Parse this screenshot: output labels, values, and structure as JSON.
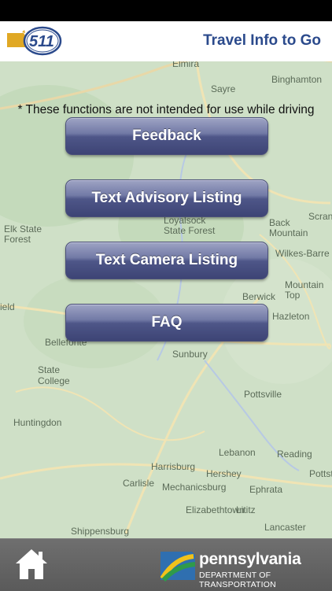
{
  "header": {
    "title": "Travel Info to Go",
    "logo_text": "511"
  },
  "disclaimer": "* These functions are not intended for use while driving",
  "menu": [
    {
      "label": "Feedback"
    },
    {
      "label": "Text Advisory Listing"
    },
    {
      "label": "Text Camera Listing"
    },
    {
      "label": "FAQ"
    }
  ],
  "map_labels": [
    "Elmira",
    "Sayre",
    "Binghamton",
    "Elk State Forest",
    "Loyalsock State Forest",
    "Back Mountain",
    "Scranton",
    "Wilkes-Barre",
    "Berwick",
    "Mountain Top",
    "Hazleton",
    "Bellefonte",
    "State College",
    "Sunbury",
    "Pottsville",
    "Huntingdon",
    "Lebanon",
    "Reading",
    "Harrisburg",
    "Hershey",
    "Carlisle",
    "Mechanicsburg",
    "Ephrata",
    "Pottstown",
    "Elizabethtown",
    "Lititz",
    "Lancaster",
    "Shippensburg",
    "ield"
  ],
  "footer": {
    "org_name": "pennsylvania",
    "org_dept": "DEPARTMENT OF TRANSPORTATION"
  },
  "colors": {
    "title": "#2b4a8c",
    "button": "#4e5688",
    "footer": "#636363",
    "map": "#cfe0c7"
  }
}
